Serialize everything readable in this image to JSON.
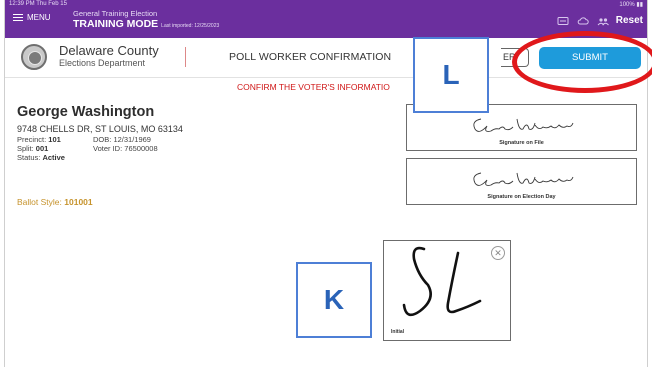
{
  "status": {
    "time": "12:39 PM  Thu Feb 15",
    "battery": "100% ▮▮"
  },
  "topbar": {
    "menu_label": "MENU",
    "election_name": "General Training Election",
    "mode": "TRAINING MODE",
    "last_imported": "Last imported: 12/25/2023",
    "reset_label": "Reset",
    "bg_color": "#6b2f9e"
  },
  "header": {
    "county_name": "Delaware County",
    "department": "Elections Department",
    "page_title": "POLL WORKER CONFIRMATION",
    "partial_button": "ER",
    "submit_label": "SUBMIT",
    "submit_color": "#1e9bdb"
  },
  "confirm_message": "CONFIRM THE VOTER'S INFORMATIO",
  "voter": {
    "name": "George  Washington",
    "address": "9748 CHELLS DR, ST LOUIS, MO 63134",
    "precinct_label": "Precinct:",
    "precinct": "101",
    "dob_label": "DOB:",
    "dob": "12/31/1969",
    "split_label": "Split:",
    "split": "001",
    "voter_id_label": "Voter ID:",
    "voter_id": "76500008",
    "status_label": "Status:",
    "status": "Active",
    "ballot_style_label": "Ballot Style:",
    "ballot_style": "101001"
  },
  "signatures": {
    "on_file_caption": "Signature on File",
    "election_day_caption": "Signature on Election Day",
    "signature_text": "George Washington"
  },
  "initial": {
    "caption": "Initial",
    "close_symbol": "✕"
  },
  "callouts": {
    "l": "L",
    "k": "K"
  },
  "annotation_color": "#e0181b"
}
